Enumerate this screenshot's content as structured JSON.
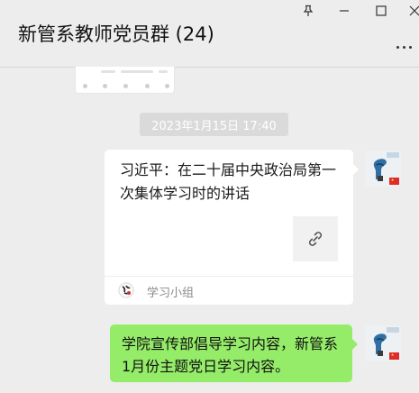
{
  "header": {
    "title": "新管系教师党员群 (24)",
    "window_controls": [
      "pin-icon",
      "minimize-icon",
      "maximize-icon",
      "close-icon"
    ],
    "more_icon": "more-options-icon"
  },
  "messages": [
    {
      "type": "timestamp",
      "text": "2023年1月15日 17:40"
    },
    {
      "type": "link-card",
      "sender": "self",
      "title": "习近平：在二十届中央政治局第一次集体学习时的讲话",
      "thumbnail_icon": "link-icon",
      "source_name": "学习小组",
      "source_icon": "source-logo-icon"
    },
    {
      "type": "text",
      "sender": "self",
      "text": "学院宣传部倡导学习内容，新管系1月份主题党日学习内容。"
    }
  ],
  "colors": {
    "background": "#ededed",
    "self_bubble": "#95ec69",
    "card": "#ffffff",
    "timestamp_bg": "#dadada"
  }
}
